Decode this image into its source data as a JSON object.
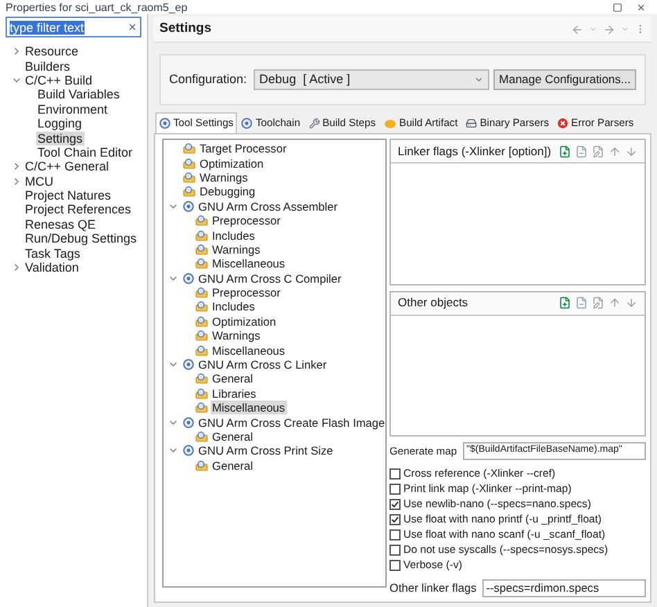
{
  "window": {
    "title": "Properties for sci_uart_ck_raom5_ep"
  },
  "filter": {
    "value": "type filter text"
  },
  "sidebar": {
    "items": [
      {
        "label": "Resource",
        "expanded": false,
        "selected": false
      },
      {
        "label": "Builders",
        "selected": false
      },
      {
        "label": "C/C++ Build",
        "expanded": true,
        "selected": false,
        "children": [
          {
            "label": "Build Variables",
            "selected": false
          },
          {
            "label": "Environment",
            "selected": false
          },
          {
            "label": "Logging",
            "selected": false
          },
          {
            "label": "Settings",
            "selected": true
          },
          {
            "label": "Tool Chain Editor",
            "selected": false
          }
        ]
      },
      {
        "label": "C/C++ General",
        "expanded": false,
        "selected": false
      },
      {
        "label": "MCU",
        "expanded": false,
        "selected": false
      },
      {
        "label": "Project Natures",
        "selected": false
      },
      {
        "label": "Project References",
        "selected": false
      },
      {
        "label": "Renesas QE",
        "selected": false
      },
      {
        "label": "Run/Debug Settings",
        "selected": false
      },
      {
        "label": "Task Tags",
        "selected": false
      },
      {
        "label": "Validation",
        "expanded": false,
        "selected": false
      }
    ]
  },
  "settings": {
    "title": "Settings",
    "configuration": {
      "label": "Configuration:",
      "value": "Debug  [ Active ]",
      "button": "Manage Configurations..."
    },
    "tabs": [
      {
        "label": "Tool Settings",
        "kind": "tool",
        "selected": true
      },
      {
        "label": "Toolchain",
        "kind": "tool",
        "selected": false
      },
      {
        "label": "Build Steps",
        "kind": "wrench",
        "selected": false
      },
      {
        "label": "Build Artifact",
        "kind": "artifact",
        "selected": false
      },
      {
        "label": "Binary Parsers",
        "kind": "binary",
        "selected": false
      },
      {
        "label": "Error Parsers",
        "kind": "error",
        "selected": false
      }
    ],
    "tool_tree": [
      {
        "label": "Target Processor",
        "kind": "option",
        "selected": false
      },
      {
        "label": "Optimization",
        "kind": "option",
        "selected": false
      },
      {
        "label": "Warnings",
        "kind": "option",
        "selected": false
      },
      {
        "label": "Debugging",
        "kind": "option",
        "selected": false
      },
      {
        "label": "GNU Arm Cross Assembler",
        "kind": "tool",
        "expanded": true,
        "selected": false,
        "children": [
          {
            "label": "Preprocessor",
            "kind": "option",
            "selected": false
          },
          {
            "label": "Includes",
            "kind": "option",
            "selected": false
          },
          {
            "label": "Warnings",
            "kind": "option",
            "selected": false
          },
          {
            "label": "Miscellaneous",
            "kind": "option",
            "selected": false
          }
        ]
      },
      {
        "label": "GNU Arm Cross C Compiler",
        "kind": "tool",
        "expanded": true,
        "selected": false,
        "children": [
          {
            "label": "Preprocessor",
            "kind": "option",
            "selected": false
          },
          {
            "label": "Includes",
            "kind": "option",
            "selected": false
          },
          {
            "label": "Optimization",
            "kind": "option",
            "selected": false
          },
          {
            "label": "Warnings",
            "kind": "option",
            "selected": false
          },
          {
            "label": "Miscellaneous",
            "kind": "option",
            "selected": false
          }
        ]
      },
      {
        "label": "GNU Arm Cross C Linker",
        "kind": "tool",
        "expanded": true,
        "selected": false,
        "children": [
          {
            "label": "General",
            "kind": "option",
            "selected": false
          },
          {
            "label": "Libraries",
            "kind": "option",
            "selected": false
          },
          {
            "label": "Miscellaneous",
            "kind": "option",
            "selected": true
          }
        ]
      },
      {
        "label": "GNU Arm Cross Create Flash Image",
        "kind": "tool",
        "expanded": true,
        "selected": false,
        "children": [
          {
            "label": "General",
            "kind": "option",
            "selected": false
          }
        ]
      },
      {
        "label": "GNU Arm Cross Print Size",
        "kind": "tool",
        "expanded": true,
        "selected": false,
        "children": [
          {
            "label": "General",
            "kind": "option",
            "selected": false
          }
        ]
      }
    ],
    "lists": [
      {
        "title": "Linker flags (-Xlinker [option])"
      },
      {
        "title": "Other objects"
      }
    ],
    "generate_map": {
      "label": "Generate map",
      "value": "\"$(BuildArtifactFileBaseName).map\""
    },
    "options": [
      {
        "label": "Cross reference (-Xlinker --cref)",
        "checked": false
      },
      {
        "label": "Print link map (-Xlinker --print-map)",
        "checked": false
      },
      {
        "label": "Use newlib-nano (--specs=nano.specs)",
        "checked": true
      },
      {
        "label": "Use float with nano printf (-u _printf_float)",
        "checked": true
      },
      {
        "label": "Use float with nano scanf (-u _scanf_float)",
        "checked": false
      },
      {
        "label": "Do not use syscalls (--specs=nosys.specs)",
        "checked": false
      },
      {
        "label": "Verbose (-v)",
        "checked": false
      }
    ],
    "other_flags": {
      "label": "Other linker flags",
      "value": "--specs=rdimon.specs"
    }
  }
}
